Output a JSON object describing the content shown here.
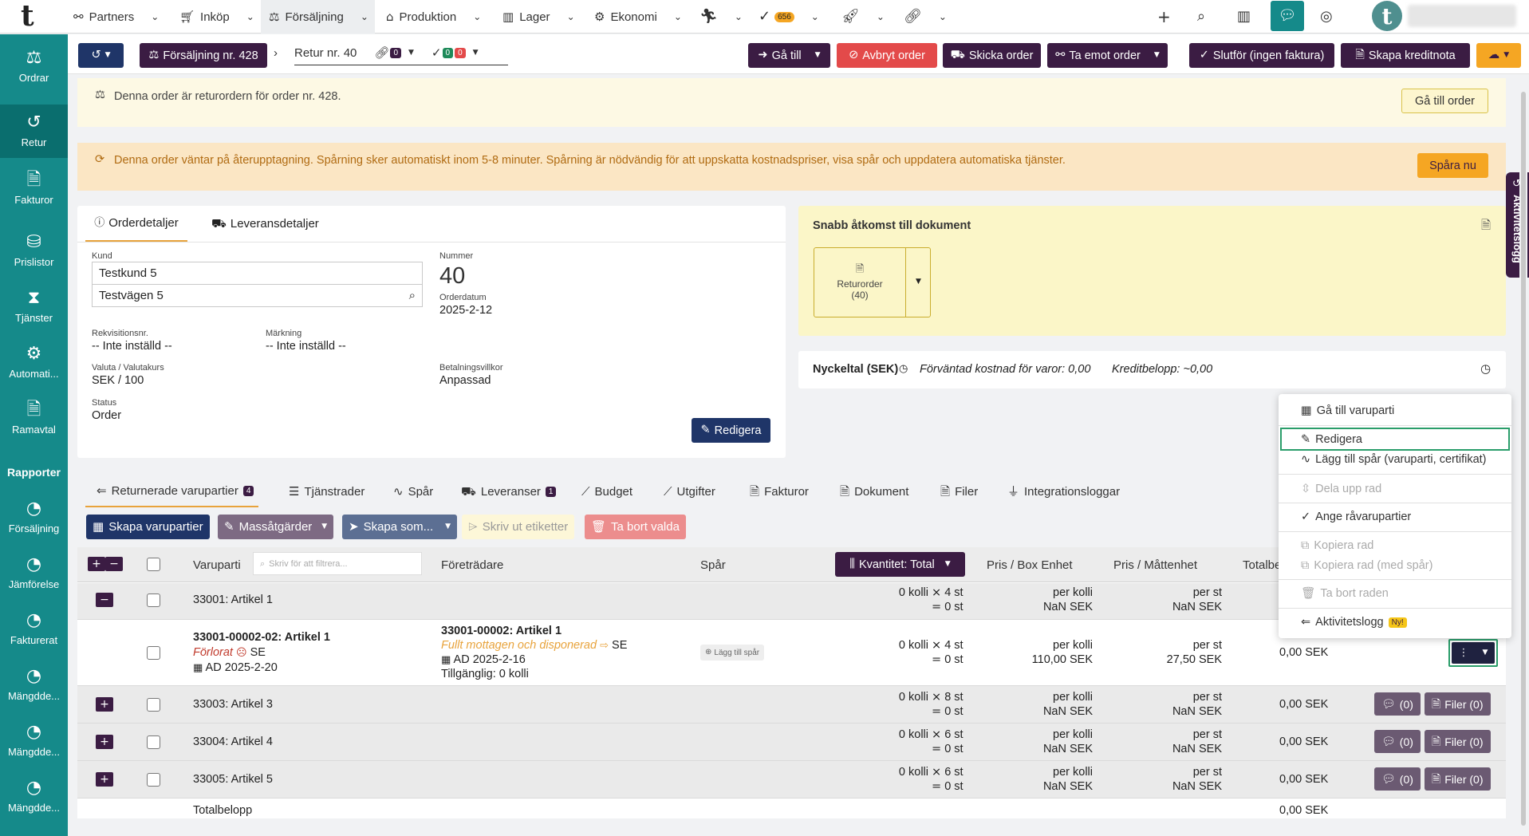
{
  "topnav": {
    "logo": "t",
    "items": [
      {
        "label": "Partners",
        "icon": "handshake-icon"
      },
      {
        "label": "Inköp",
        "icon": "cart-icon"
      },
      {
        "label": "Försäljning",
        "icon": "sales-icon"
      },
      {
        "label": "Produktion",
        "icon": "production-icon"
      },
      {
        "label": "Lager",
        "icon": "warehouse-icon"
      },
      {
        "label": "Ekonomi",
        "icon": "economy-icon"
      }
    ],
    "tasks_badge": "656",
    "avatar_letter": "t"
  },
  "sidebar": {
    "items": [
      {
        "label": "Ordrar",
        "icon": "orders-icon"
      },
      {
        "label": "Retur",
        "icon": "return-icon"
      },
      {
        "label": "Fakturor",
        "icon": "invoice-icon"
      },
      {
        "label": "Prislistor",
        "icon": "pricelist-icon"
      },
      {
        "label": "Tjänster",
        "icon": "hourglass-icon"
      },
      {
        "label": "Automati...",
        "icon": "robot-icon"
      },
      {
        "label": "Ramavtal",
        "icon": "contract-icon"
      }
    ],
    "section": "Rapporter",
    "reports": [
      {
        "label": "Försäljning",
        "icon": "pie-chart-icon"
      },
      {
        "label": "Jämförelse",
        "icon": "pie-chart-icon"
      },
      {
        "label": "Fakturerat",
        "icon": "pie-chart-icon"
      },
      {
        "label": "Mängdde...",
        "icon": "pie-chart-icon"
      },
      {
        "label": "Mängdde...",
        "icon": "pie-chart-icon"
      },
      {
        "label": "Mängdde...",
        "icon": "pie-chart-icon"
      }
    ]
  },
  "toolbar": {
    "parent_order": "Försäljning nr. 428",
    "current": "Retur nr. 40",
    "links_count": "0",
    "checks_ok": "0",
    "checks_fail": "0",
    "goto": "Gå till",
    "cancel": "Avbryt order",
    "send": "Skicka order",
    "receive": "Ta emot order",
    "finish": "Slutför (ingen faktura)",
    "credit": "Skapa kreditnota"
  },
  "banner1": {
    "text": "Denna order är returordern för order nr. 428.",
    "button": "Gå till order"
  },
  "banner2": {
    "text": "Denna order väntar på återupptagning. Spårning sker automatiskt inom 5-8 minuter. Spårning är nödvändig för att uppskatta kostnadspriser, visa spår och uppdatera automatiska tjänster.",
    "button": "Spåra nu"
  },
  "details": {
    "tab_order": "Orderdetaljer",
    "tab_delivery": "Leveransdetaljer",
    "kund_label": "Kund",
    "kund": "Testkund 5",
    "address": "Testvägen 5",
    "nummer_label": "Nummer",
    "nummer": "40",
    "orderdatum_label": "Orderdatum",
    "orderdatum": "2025-2-12",
    "rekv_label": "Rekvisitionsnr.",
    "rekv": "-- Inte inställd --",
    "markning_label": "Märkning",
    "markning": "-- Inte inställd --",
    "valuta_label": "Valuta / Valutakurs",
    "valuta": "SEK / 100",
    "betal_label": "Betalningsvillkor",
    "betal": "Anpassad",
    "status_label": "Status",
    "status": "Order",
    "edit": "Redigera"
  },
  "docs": {
    "title": "Snabb åtkomst till dokument",
    "doc_label": "Returorder",
    "doc_num": "(40)"
  },
  "kpi": {
    "label": "Nyckeltal (SEK)",
    "expected": "Förväntad kostnad för varor: 0,00",
    "credit": "Kreditbelopp: ~0,00"
  },
  "tabs": [
    {
      "label": "Returnerade varupartier",
      "count": "4"
    },
    {
      "label": "Tjänstrader"
    },
    {
      "label": "Spår"
    },
    {
      "label": "Leveranser",
      "count": "1"
    },
    {
      "label": "Budget"
    },
    {
      "label": "Utgifter"
    },
    {
      "label": "Fakturor"
    },
    {
      "label": "Dokument"
    },
    {
      "label": "Filer"
    },
    {
      "label": "Integrationsloggar"
    }
  ],
  "actions": {
    "create": "Skapa varupartier",
    "mass": "Massåtgärder",
    "create_as": "Skapa som...",
    "print": "Skriv ut etiketter",
    "delete": "Ta bort valda"
  },
  "table": {
    "col_lot": "Varuparti",
    "filter_placeholder": "Skriv för att filtrera...",
    "col_pred": "Företrädare",
    "col_track": "Spår",
    "qty_mode": "Kvantitet: Total",
    "col_price_box": "Pris / Box Enhet",
    "col_price_unit": "Pris / Måttenhet",
    "col_total": "Totalbe",
    "groups": [
      {
        "name": "33001: Artikel 1",
        "qty_top": "0 kolli",
        "qty_mult": "4 st",
        "qty_eq": "0 st",
        "p1_top": "per kolli",
        "p1_bot": "NaN SEK",
        "p2_top": "per st",
        "p2_bot": "NaN SEK"
      },
      {
        "name": "33003: Artikel 3",
        "qty_top": "0 kolli",
        "qty_mult": "8 st",
        "qty_eq": "0 st",
        "p1_top": "per kolli",
        "p1_bot": "NaN SEK",
        "p2_top": "per st",
        "p2_bot": "NaN SEK",
        "total": "0,00 SEK",
        "comments": "(0)",
        "files": "Filer (0)"
      },
      {
        "name": "33004: Artikel 4",
        "qty_top": "0 kolli",
        "qty_mult": "6 st",
        "qty_eq": "0 st",
        "p1_top": "per kolli",
        "p1_bot": "NaN SEK",
        "p2_top": "per st",
        "p2_bot": "NaN SEK",
        "total": "0,00 SEK",
        "comments": "(0)",
        "files": "Filer (0)"
      },
      {
        "name": "33005: Artikel 5",
        "qty_top": "0 kolli",
        "qty_mult": "6 st",
        "qty_eq": "0 st",
        "p1_top": "per kolli",
        "p1_bot": "NaN SEK",
        "p2_top": "per st",
        "p2_bot": "NaN SEK",
        "total": "0,00 SEK",
        "comments": "(0)",
        "files": "Filer (0)"
      }
    ],
    "detail": {
      "lot": "33001-00002-02: Artikel 1",
      "lot_status": "Förlorat",
      "lot_country": "SE",
      "lot_date": "AD 2025-2-20",
      "pred": "33001-00002: Artikel 1",
      "pred_status": "Fullt mottagen och disponerad",
      "pred_country": "SE",
      "pred_date": "AD 2025-2-16",
      "pred_avail": "Tillgänglig: 0 kolli",
      "track_btn": "Lägg till spår",
      "qty_top": "0 kolli",
      "qty_mult": "4 st",
      "qty_eq": "0 st",
      "p1_top": "per kolli",
      "p1_bot": "110,00 SEK",
      "p2_top": "per st",
      "p2_bot": "27,50 SEK",
      "total": "0,00 SEK"
    },
    "footer_label": "Totalbelopp",
    "footer_total": "0,00 SEK"
  },
  "menu": {
    "goto": "Gå till varuparti",
    "edit": "Redigera",
    "add_track": "Lägg till spår (varuparti, certifikat)",
    "split": "Dela upp rad",
    "raw": "Ange råvarupartier",
    "copy": "Kopiera rad",
    "copy_track": "Kopiera rad (med spår)",
    "delete": "Ta bort raden",
    "activity": "Aktivitetslogg",
    "new_badge": "Ny!"
  },
  "side_tab": "Aktivitetslogg"
}
